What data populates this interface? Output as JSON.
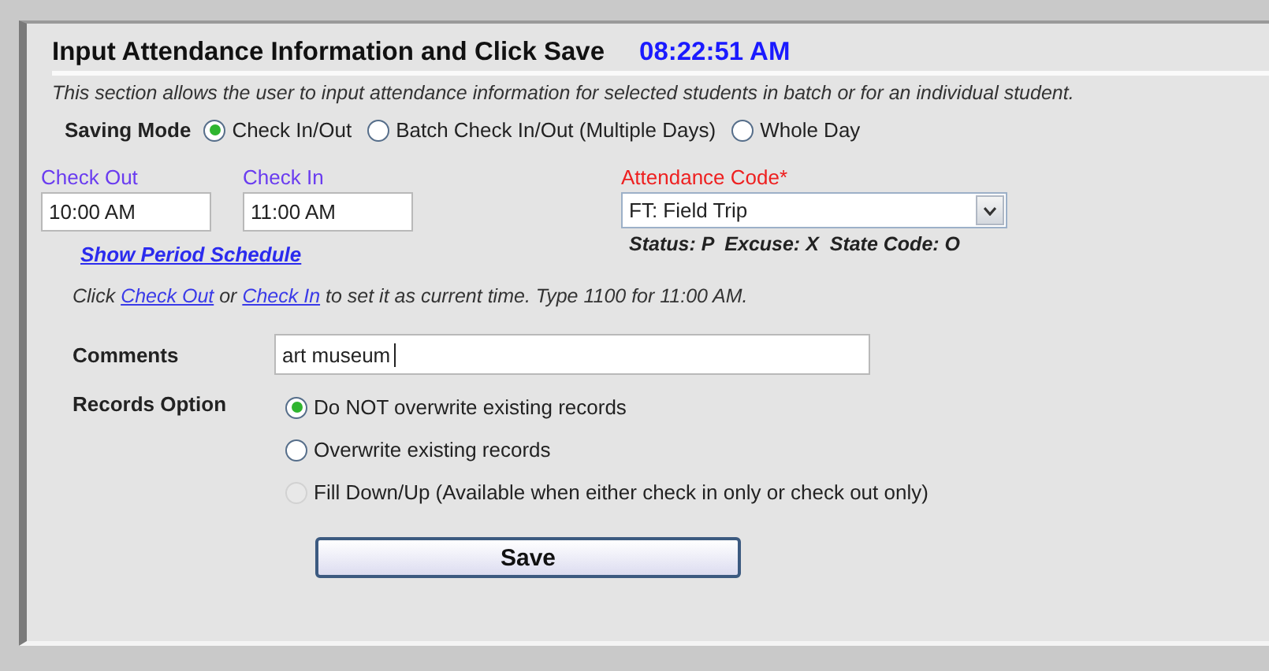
{
  "header": {
    "title": "Input Attendance Information and Click Save",
    "time": "08:22:51 AM"
  },
  "description": "This section allows the user to input attendance information for selected students in batch or for an individual student.",
  "saving_mode": {
    "label": "Saving Mode",
    "options": [
      {
        "label": "Check In/Out",
        "selected": true
      },
      {
        "label": "Batch Check In/Out (Multiple Days)",
        "selected": false
      },
      {
        "label": "Whole Day",
        "selected": false
      }
    ]
  },
  "check_out": {
    "label": "Check Out",
    "value": "10:00 AM"
  },
  "check_in": {
    "label": "Check In",
    "value": "11:00 AM"
  },
  "attendance_code": {
    "label": "Attendance Code*",
    "value": "FT: Field Trip",
    "info": "Status: P  Excuse: X  State Code: O"
  },
  "period_link": "Show Period Schedule",
  "hint": {
    "before": "Click ",
    "link_1": "Check Out",
    "middle": " or ",
    "link_2": "Check In",
    "after": " to set it as current time. Type 1100 for 11:00 AM."
  },
  "comments": {
    "label": "Comments",
    "value": "art museum "
  },
  "records_option": {
    "label": "Records Option",
    "options": [
      {
        "label": "Do NOT overwrite existing records",
        "selected": true,
        "disabled": false
      },
      {
        "label": "Overwrite existing records",
        "selected": false,
        "disabled": false
      },
      {
        "label": "Fill Down/Up (Available when either check in only or check out only)",
        "selected": false,
        "disabled": true
      }
    ]
  },
  "save_button": "Save"
}
